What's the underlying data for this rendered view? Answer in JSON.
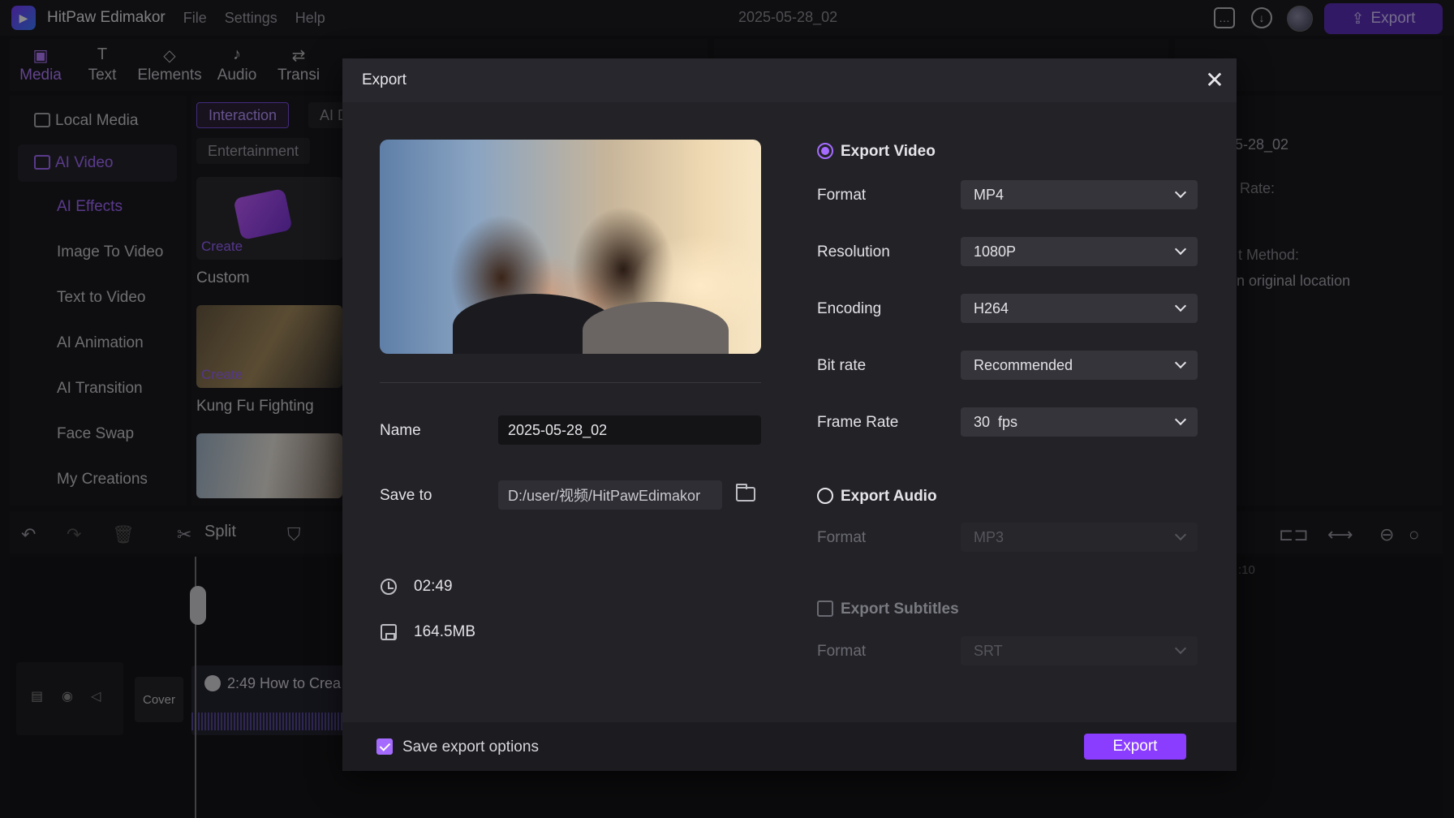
{
  "titlebar": {
    "app_name": "HitPaw Edimakor",
    "menus": [
      "File",
      "Settings",
      "Help"
    ],
    "doc_title": "2025-05-28_02",
    "export_label": "Export"
  },
  "toolbar": {
    "tabs": [
      {
        "label": "Media",
        "icon": "media-icon"
      },
      {
        "label": "Text",
        "icon": "text-icon"
      },
      {
        "label": "Elements",
        "icon": "elements-icon"
      },
      {
        "label": "Audio",
        "icon": "audio-icon"
      },
      {
        "label": "Transi",
        "icon": "transition-icon"
      }
    ]
  },
  "sidebar": {
    "items": [
      {
        "label": "Local Media"
      },
      {
        "label": "AI Video"
      },
      {
        "label": "AI Effects"
      },
      {
        "label": "Image To Video"
      },
      {
        "label": "Text to Video"
      },
      {
        "label": "AI Animation"
      },
      {
        "label": "AI Transition"
      },
      {
        "label": "Face Swap"
      },
      {
        "label": "My Creations"
      }
    ]
  },
  "content": {
    "chips": [
      "Interaction",
      "AI D",
      "Entertainment"
    ],
    "cards": [
      {
        "create": "Create",
        "label": "Custom"
      },
      {
        "create": "Create",
        "label": "Kung Fu Fighting"
      }
    ]
  },
  "right_panel": {
    "name_value": "5-28_02",
    "rate_label": "Rate:",
    "method_label": "t Method:",
    "location_text": "n original location"
  },
  "timeline": {
    "split_label": "Split",
    "cover_label": "Cover",
    "clip_title": "2:49 How to Crea",
    "ruler_label": ":10"
  },
  "modal": {
    "title": "Export",
    "name_label": "Name",
    "name_value": "2025-05-28_02",
    "save_to_label": "Save to",
    "save_to_value": "D:/user/视频/HitPawEdimakor",
    "duration": "02:49",
    "size": "164.5MB",
    "export_video": {
      "label": "Export Video",
      "checked": true,
      "options": [
        {
          "label": "Format",
          "value": "MP4"
        },
        {
          "label": "Resolution",
          "value": "1080P"
        },
        {
          "label": "Encoding",
          "value": "H264"
        },
        {
          "label": "Bit rate",
          "value": "Recommended"
        },
        {
          "label": "Frame Rate",
          "value": "30  fps"
        }
      ]
    },
    "export_audio": {
      "label": "Export Audio",
      "checked": false,
      "format_label": "Format",
      "format_value": "MP3"
    },
    "export_subtitles": {
      "label": "Export Subtitles",
      "checked": false,
      "format_label": "Format",
      "format_value": "SRT"
    },
    "save_options_label": "Save export options",
    "save_options_checked": true,
    "export_button": "Export"
  },
  "colors": {
    "accent": "#8a3cff",
    "accent_light": "#a56bff",
    "background": "#16161a",
    "panel": "#222227"
  }
}
